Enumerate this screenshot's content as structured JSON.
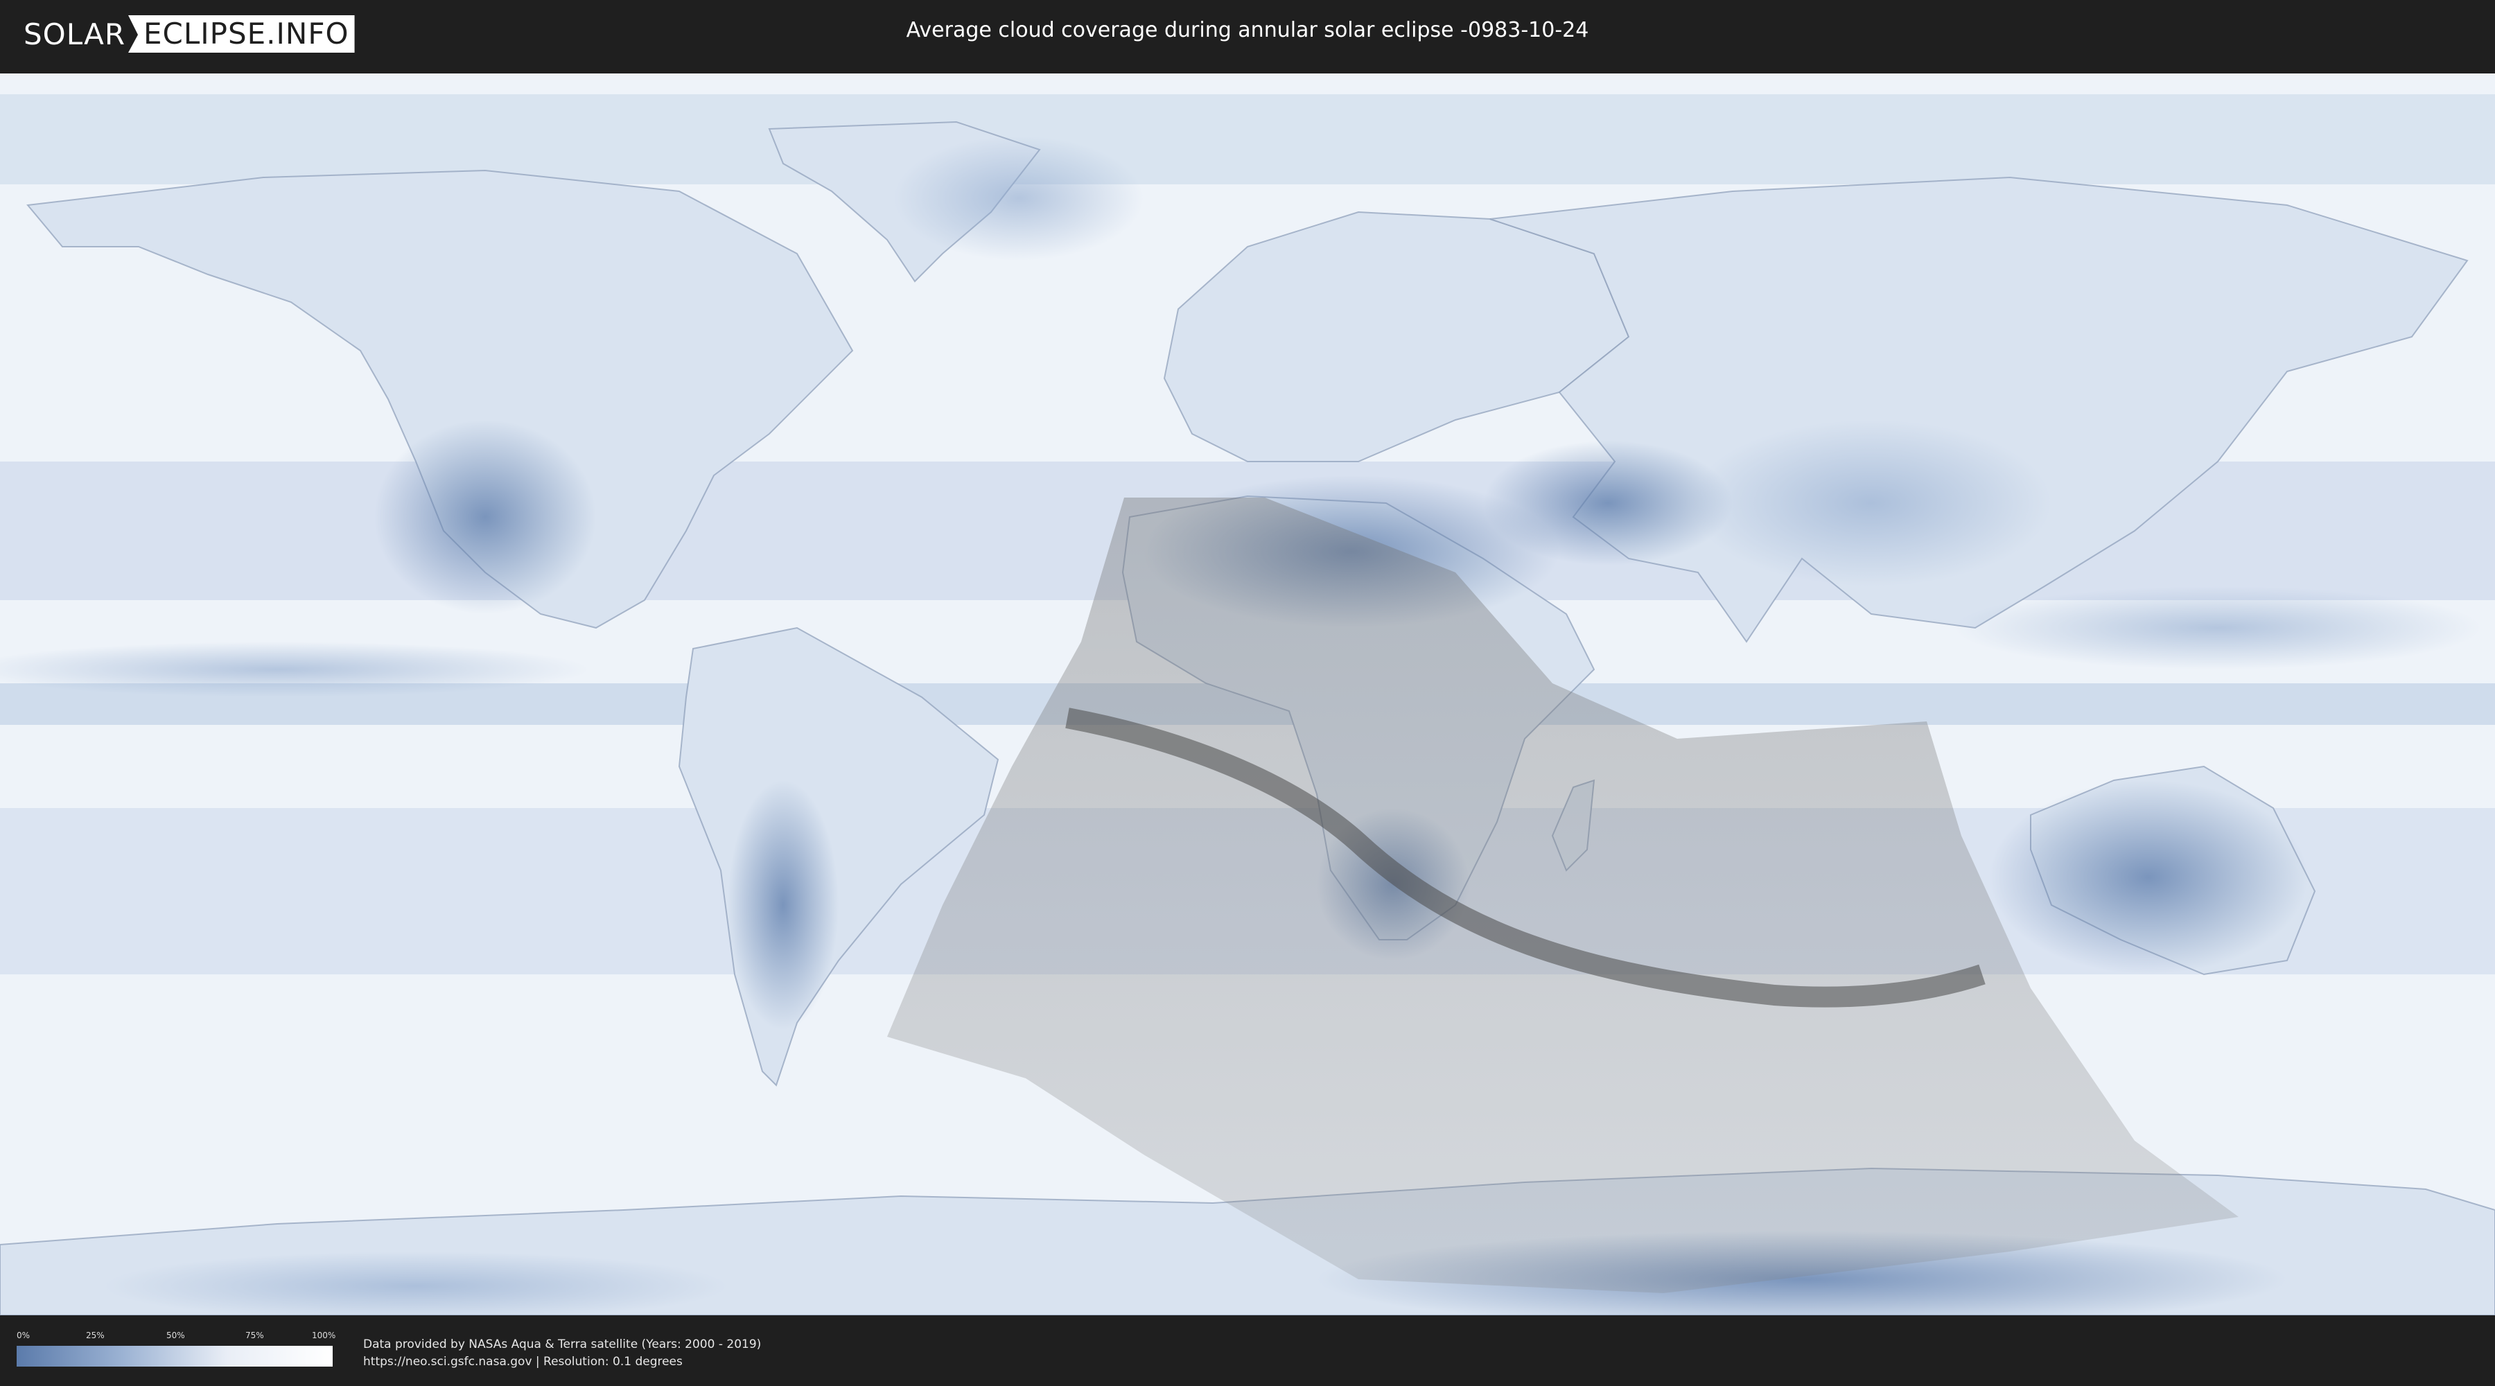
{
  "header": {
    "logo_left": "SOLAR",
    "logo_right": "ECLIPSE.INFO",
    "title": "Average cloud coverage during annular solar eclipse -0983-10-24"
  },
  "map": {
    "ocean_color": "#eef3f9",
    "cloud_dark_color": "#5b7bab",
    "eclipse_shade_color": "#7a7a7a",
    "central_path_color": "#4a4a4a"
  },
  "legend": {
    "ticks": [
      "0%",
      "25%",
      "50%",
      "75%",
      "100%"
    ],
    "gradient_start": "#5b7bab",
    "gradient_end": "#ffffff"
  },
  "footer": {
    "credit_line_1": "Data provided by NASAs Aqua & Terra satellite (Years: 2000 - 2019)",
    "credit_line_2": "https://neo.sci.gsfc.nasa.gov | Resolution: 0.1 degrees"
  }
}
